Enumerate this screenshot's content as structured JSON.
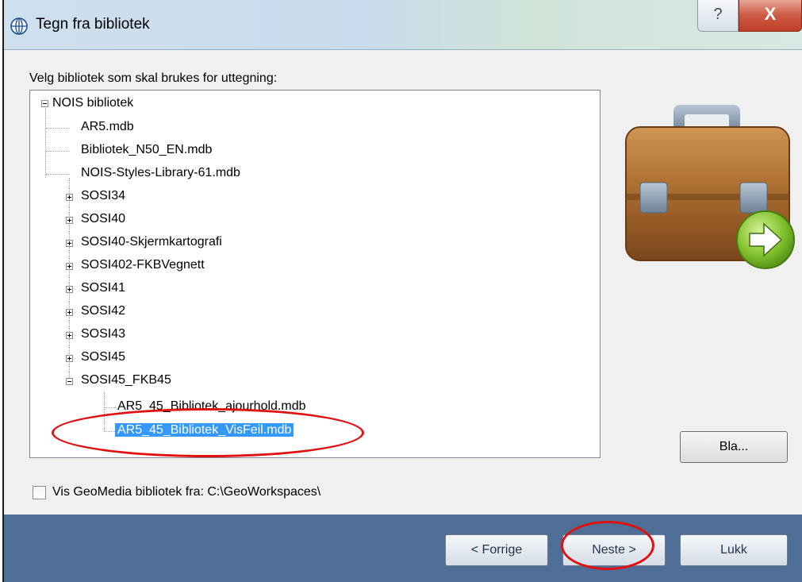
{
  "window": {
    "title": "Tegn fra bibliotek",
    "help_label": "?",
    "close_label": "X"
  },
  "prompt": "Velg bibliotek som skal brukes for uttegning:",
  "tree": {
    "root": "NOIS bibliotek",
    "files": [
      "AR5.mdb",
      "Bibliotek_N50_EN.mdb",
      "NOIS-Styles-Library-61.mdb"
    ],
    "folders": [
      "SOSI34",
      "SOSI40",
      "SOSI40-Skjermkartografi",
      "SOSI402-FKBVegnett",
      "SOSI41",
      "SOSI42",
      "SOSI43",
      "SOSI45"
    ],
    "open_folder": "SOSI45_FKB45",
    "open_folder_children": [
      "AR5_45_Bibliotek_ajourhold.mdb",
      "AR5_45_Bibliotek_VisFeil.mdb"
    ],
    "selected": "AR5_45_Bibliotek_VisFeil.mdb"
  },
  "browse_label": "Bla...",
  "checkbox": {
    "label": "Vis GeoMedia bibliotek fra: C:\\GeoWorkspaces\\",
    "checked": false
  },
  "buttons": {
    "prev": "< Forrige",
    "next": "Neste >",
    "close": "Lukk"
  },
  "colors": {
    "selection": "#3399ff",
    "bottom_bar": "#4e6d97",
    "annotation": "#e01010"
  },
  "icons": [
    "globe-icon",
    "help-icon",
    "close-icon",
    "briefcase-icon",
    "arrow-right-icon"
  ]
}
